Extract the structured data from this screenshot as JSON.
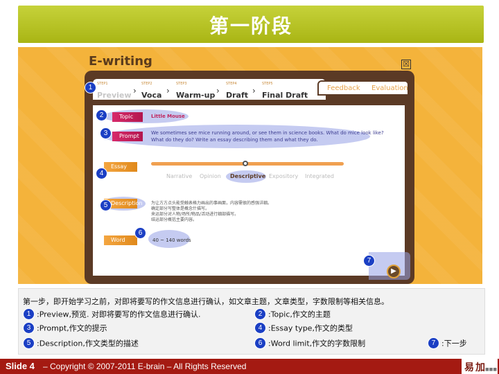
{
  "title": "第一阶段",
  "app": {
    "logo": "E-writing",
    "close_glyph": "☒",
    "steps": [
      {
        "num": "STEP1",
        "name": "Preview"
      },
      {
        "num": "STEP2",
        "name": "Voca"
      },
      {
        "num": "STEP3",
        "name": "Warm-up"
      },
      {
        "num": "STEP4",
        "name": "Draft"
      },
      {
        "num": "STEP5",
        "name": "Final Draft"
      }
    ],
    "side_tabs": [
      "Feedback",
      "Evaluation"
    ],
    "topic_label": "Topic",
    "topic_value": "Little Mouse",
    "prompt_label": "Prompt",
    "prompt_text_1": "We sometimes see mice running around, or see them in science books. What do mice look like?",
    "prompt_text_2": "What do they do? Write an essay describing them and what they do.",
    "essay_type_label": "Essay Type",
    "essay_types": [
      "Narrative",
      "Opinion",
      "Descriptive",
      "Expository",
      "Integrated"
    ],
    "selected_essay_type_index": 2,
    "description_label": "Description",
    "description_lines": [
      "为让方方点头能受触表格力画出的事画面，内容需很的感强详细。",
      "确定部分写整体是概念什描写。",
      "来运部分对人物/场所/物品/活动进行细部描写。",
      "结运部分概括主要内容。"
    ],
    "word_limit_label": "Word Limit",
    "word_limit_value": "40 ~ 140 words",
    "next_glyph": "▶"
  },
  "callouts": [
    "1",
    "2",
    "3",
    "4",
    "5",
    "6",
    "7"
  ],
  "explanation": {
    "intro": "第一步，即开始学习之前，对即将要写的作文信息进行确认，如文章主题，文章类型，字数限制等相关信息。",
    "items": [
      {
        "num": "1",
        "text": ":Preview,预览. 对即将要写的作文信息进行确认."
      },
      {
        "num": "2",
        "text": ":Topic,作文的主题"
      },
      {
        "num": "3",
        "text": ":Prompt,作文的提示"
      },
      {
        "num": "4",
        "text": ":Essay type,作文的类型"
      },
      {
        "num": "5",
        "text": ":Description,作文类型的描述"
      },
      {
        "num": "6",
        "text": ":Word limit,作文的字数限制"
      },
      {
        "num": "7",
        "text": ":下一步"
      }
    ]
  },
  "footer": {
    "slide": "Slide 4",
    "copyright": "– Copyright © 2007-2011 E-brain – All Rights Reserved"
  },
  "colors": {
    "banner": "#b5c224",
    "app_bg": "#f4b33b",
    "book": "#5b3a25",
    "badge": "#1b3fc4",
    "footer": "#a41a12"
  }
}
